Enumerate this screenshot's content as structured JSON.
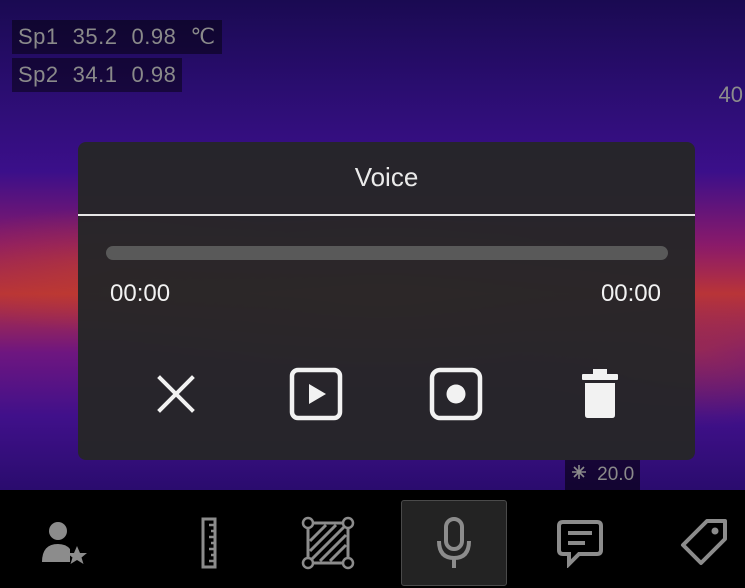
{
  "overlay": {
    "sp1": {
      "label": "Sp1",
      "temp": "35.2",
      "emissivity": "0.98",
      "unit": "℃"
    },
    "sp2": {
      "label": "Sp2",
      "temp": "34.1",
      "emissivity": "0.98"
    },
    "scale_high": "40",
    "scale_low": "20.0"
  },
  "dialog": {
    "title": "Voice",
    "progress_fraction": 0,
    "time_elapsed": "00:00",
    "time_total": "00:00",
    "buttons": {
      "close": "close-icon",
      "play": "play-icon",
      "record": "record-icon",
      "delete": "trash-icon"
    }
  },
  "toolbar": {
    "items": [
      {
        "icon": "user-star-icon",
        "active": false
      },
      {
        "icon": "ruler-icon",
        "active": false
      },
      {
        "icon": "area-box-icon",
        "active": false
      },
      {
        "icon": "microphone-icon",
        "active": true
      },
      {
        "icon": "text-note-icon",
        "active": false
      },
      {
        "icon": "tag-icon",
        "active": false
      }
    ]
  },
  "colors": {
    "dialog_bg": "#262628",
    "text": "#f2f2f2",
    "progress_track": "#595959",
    "readout_text": "#8a8a8a"
  }
}
